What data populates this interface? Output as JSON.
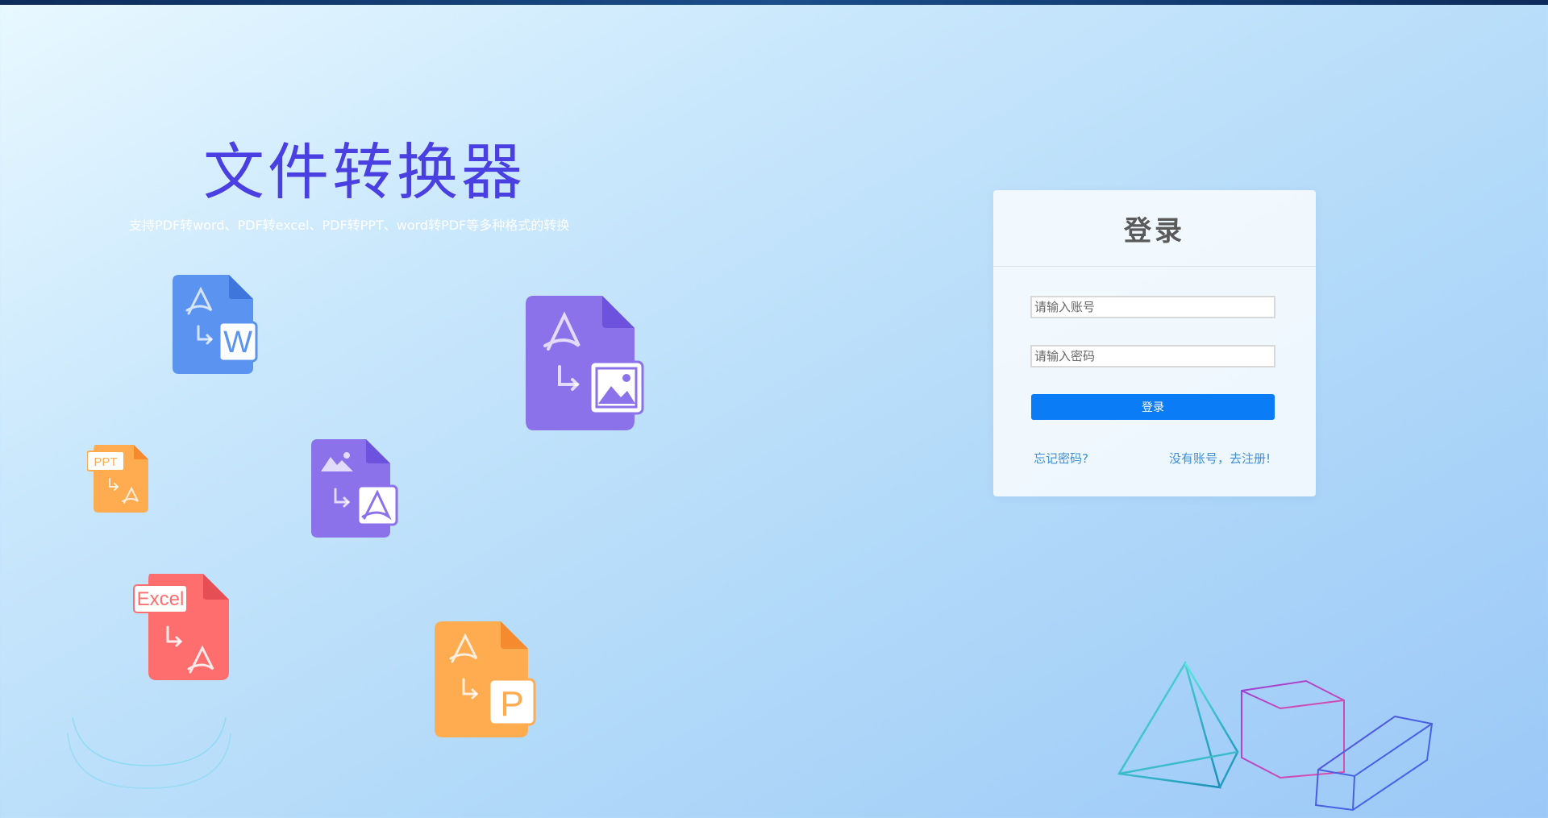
{
  "app": {
    "title": "文件转换器",
    "subtitle": "支持PDF转word、PDF转excel、PDF转PPT、word转PDF等多种格式的转换"
  },
  "icons": {
    "pdf_to_word": {
      "name": "pdf-to-word-icon",
      "color": "#5b93f0",
      "badge": "W"
    },
    "pdf_to_image": {
      "name": "pdf-to-image-icon",
      "color": "#8b72ea"
    },
    "ppt_to_pdf": {
      "name": "ppt-to-pdf-icon",
      "color": "#ffab50",
      "badge": "PPT"
    },
    "image_to_pdf": {
      "name": "image-to-pdf-icon",
      "color": "#8b72ea"
    },
    "excel_to_pdf": {
      "name": "excel-to-pdf-icon",
      "color": "#ff6e6e",
      "badge": "Excel"
    },
    "pdf_to_ppt": {
      "name": "pdf-to-ppt-icon",
      "color": "#ffab50",
      "badge": "P"
    }
  },
  "login": {
    "title": "登录",
    "account_placeholder": "请输入账号",
    "password_placeholder": "请输入密码",
    "submit_label": "登录",
    "forgot_label": "忘记密码?",
    "register_label": "没有账号，去注册!"
  },
  "colors": {
    "accent": "#0a7cf5",
    "title": "#4a3fe0",
    "link": "#3d8fd8"
  }
}
